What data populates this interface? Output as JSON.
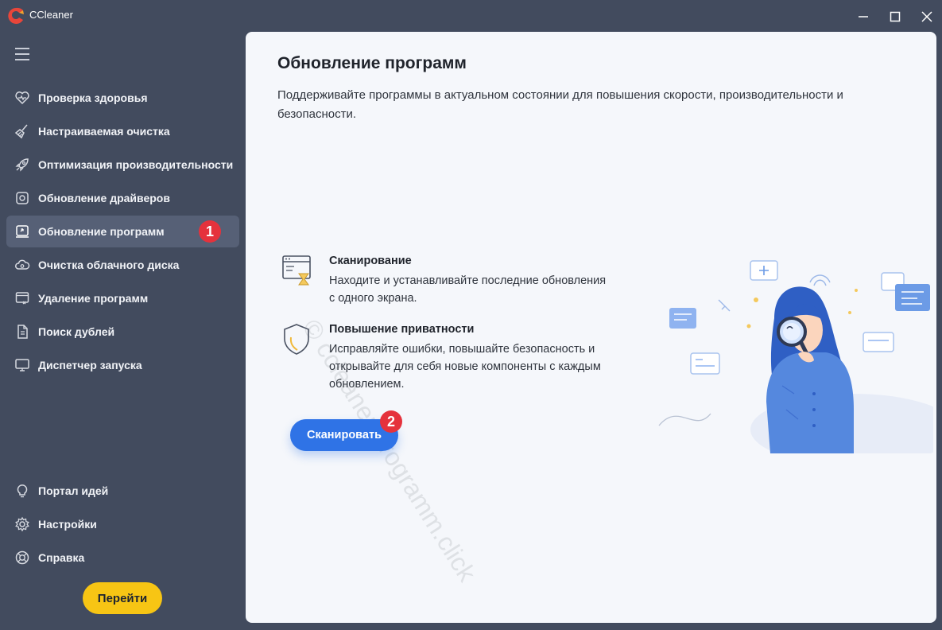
{
  "window": {
    "title": "CCleaner"
  },
  "sidebar": {
    "items": [
      {
        "label": "Проверка здоровья",
        "icon": "heart-icon"
      },
      {
        "label": "Настраиваемая очистка",
        "icon": "broom-icon"
      },
      {
        "label": "Оптимизация производительности",
        "icon": "rocket-icon"
      },
      {
        "label": "Обновление драйверов",
        "icon": "driver-gear-icon"
      },
      {
        "label": "Обновление программ",
        "icon": "software-update-icon",
        "active": true
      },
      {
        "label": "Очистка облачного диска",
        "icon": "cloud-icon"
      },
      {
        "label": "Удаление программ",
        "icon": "uninstall-icon"
      },
      {
        "label": "Поиск дублей",
        "icon": "duplicate-file-icon"
      },
      {
        "label": "Диспетчер запуска",
        "icon": "monitor-icon"
      }
    ],
    "bottom_items": [
      {
        "label": "Портал идей",
        "icon": "lightbulb-icon"
      },
      {
        "label": "Настройки",
        "icon": "gear-icon"
      },
      {
        "label": "Справка",
        "icon": "help-icon"
      }
    ],
    "go_button": "Перейти"
  },
  "main": {
    "title": "Обновление программ",
    "description": "Поддерживайте программы в актуальном состоянии для повышения скорости, производительности и безопасности.",
    "features": [
      {
        "title": "Сканирование",
        "text": "Находите и устанавливайте последние обновления с одного экрана.",
        "icon": "scan-window-icon"
      },
      {
        "title": "Повышение приватности",
        "text": "Исправляйте ошибки, повышайте безопасность и открывайте для себя новые компоненты с каждым обновлением.",
        "icon": "shield-icon"
      }
    ],
    "scan_button": "Сканировать",
    "watermark": "© ccleaner-programm.click"
  },
  "badges": {
    "first": "1",
    "second": "2"
  },
  "colors": {
    "sidebar_bg": "#424b5e",
    "active_item": "#566076",
    "main_bg": "#f5f7fb",
    "primary": "#2f73e6",
    "go_button": "#f7c514",
    "badge": "#e5323c"
  }
}
